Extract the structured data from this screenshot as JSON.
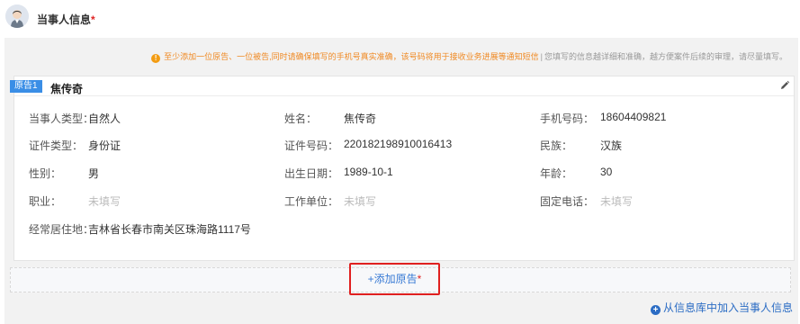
{
  "header": {
    "title": "当事人信息",
    "required_mark": "*"
  },
  "notice": {
    "warning_text": "至少添加一位原告、一位被告,同时请确保填写的手机号真实准确，该号码将用于接收业务进展等通知短信",
    "separator": "|",
    "info_text": "您填写的信息越详细和准确，越方便案件后续的审理，请尽量填写。"
  },
  "card": {
    "role_tag": "原告1",
    "name": "焦传奇",
    "fields": {
      "party_type": {
        "label": "当事人类型：",
        "value": "自然人"
      },
      "name": {
        "label": "姓名：",
        "value": "焦传奇"
      },
      "phone": {
        "label": "手机号码：",
        "value": "18604409821"
      },
      "id_type": {
        "label": "证件类型：",
        "value": "身份证"
      },
      "id_number": {
        "label": "证件号码：",
        "value": "220182198910016413"
      },
      "ethnicity": {
        "label": "民族：",
        "value": "汉族"
      },
      "gender": {
        "label": "性别：",
        "value": "男"
      },
      "birth_date": {
        "label": "出生日期：",
        "value": "1989-10-1"
      },
      "age": {
        "label": "年龄：",
        "value": "30"
      },
      "occupation": {
        "label": "职业：",
        "value": "未填写"
      },
      "employer": {
        "label": "工作单位：",
        "value": "未填写"
      },
      "landline": {
        "label": "固定电话：",
        "value": "未填写"
      },
      "address": {
        "label": "经常居住地：",
        "value": "吉林省长春市南关区珠海路1117号"
      }
    }
  },
  "add_plaintiff": {
    "label": "+添加原告",
    "required_mark": "*"
  },
  "library_link": {
    "icon": "plus-circle-icon",
    "label": "从信息库中加入当事人信息"
  },
  "colors": {
    "accent": "#3a8ee6",
    "warning": "#f08a24",
    "highlight_border": "#e02020",
    "link": "#2b6cc4"
  }
}
